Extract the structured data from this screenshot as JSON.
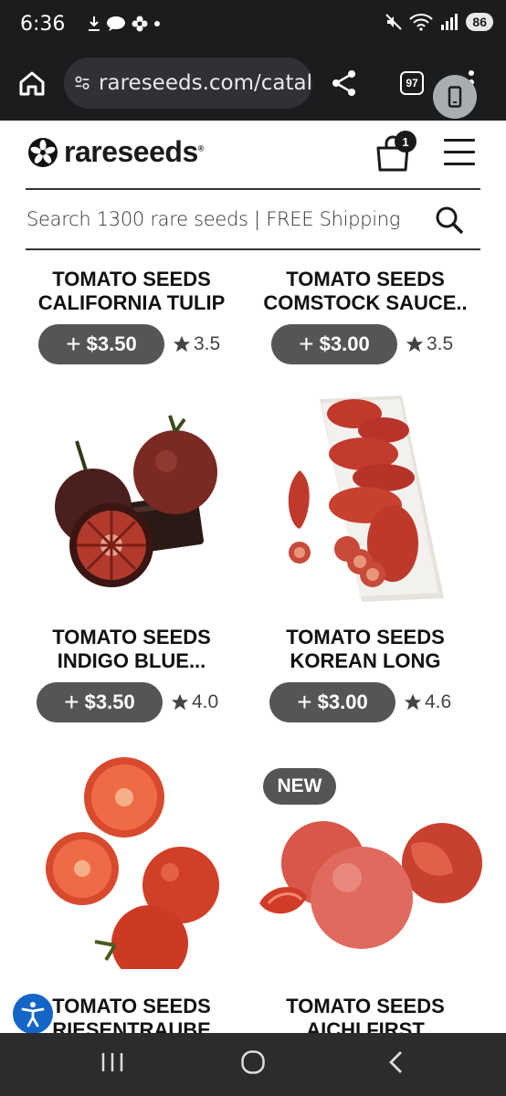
{
  "status_bar": {
    "time": "6:36",
    "battery": "86",
    "left_icons": [
      "download-icon",
      "talk-icon",
      "flower-icon",
      "dot-icon"
    ],
    "right_icons": [
      "mute-icon",
      "wifi-6e-icon",
      "signal-icon"
    ]
  },
  "browser": {
    "url": "rareseeds.com/catal",
    "tabs_count": "97"
  },
  "site": {
    "logo_text": "rareseeds",
    "logo_mark": "®",
    "cart_count": "1",
    "search_placeholder": "Search 1300 rare seeds | FREE Shipping"
  },
  "products": [
    {
      "title_1": "TOMATO SEEDS",
      "title_2": "CALIFORNIA TULIP",
      "price": "$3.50",
      "rating": "3.5"
    },
    {
      "title_1": "TOMATO SEEDS",
      "title_2": "COMSTOCK SAUCE..",
      "price": "$3.00",
      "rating": "3.5"
    },
    {
      "title_1": "TOMATO SEEDS",
      "title_2": "INDIGO BLUE...",
      "price": "$3.50",
      "rating": "4.0"
    },
    {
      "title_1": "TOMATO SEEDS",
      "title_2": "KOREAN LONG",
      "price": "$3.00",
      "rating": "4.6"
    },
    {
      "title_1": "TOMATO SEEDS",
      "title_2": "RIESENTRAUBE",
      "price": "",
      "rating": ""
    },
    {
      "title_1": "TOMATO SEEDS",
      "title_2": "AICHI FIRST",
      "price": "",
      "rating": "",
      "badge": "NEW"
    }
  ],
  "colors": {
    "chrome_dark": "#1b1c1e",
    "price_button": "#555555",
    "accessibility_blue": "#1465c6"
  }
}
